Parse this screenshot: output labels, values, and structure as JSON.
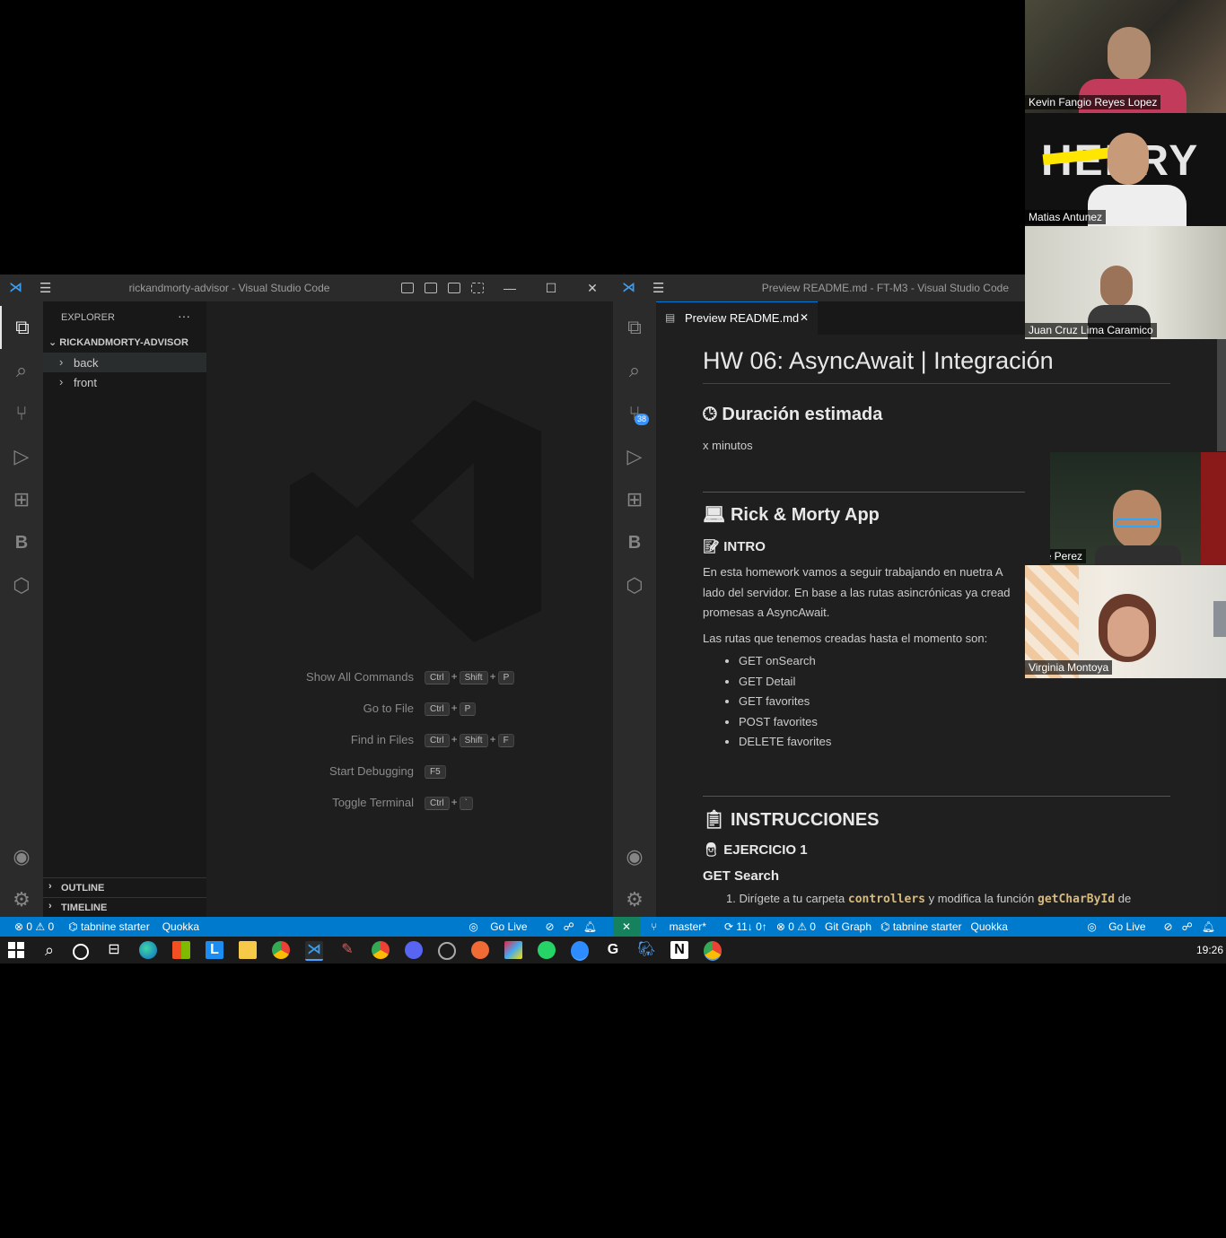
{
  "left_window": {
    "title": "rickandmorty-advisor - Visual Studio Code",
    "explorer_label": "EXPLORER",
    "explorer_more": "···",
    "root_folder": "RICKANDMORTY-ADVISOR",
    "folders": [
      "back",
      "front"
    ],
    "outline_label": "OUTLINE",
    "timeline_label": "TIMELINE",
    "shortcuts": [
      {
        "label": "Show All Commands",
        "keys": [
          "Ctrl",
          "+",
          "Shift",
          "+",
          "P"
        ]
      },
      {
        "label": "Go to File",
        "keys": [
          "Ctrl",
          "+",
          "P"
        ]
      },
      {
        "label": "Find in Files",
        "keys": [
          "Ctrl",
          "+",
          "Shift",
          "+",
          "F"
        ]
      },
      {
        "label": "Start Debugging",
        "keys": [
          "F5"
        ]
      },
      {
        "label": "Toggle Terminal",
        "keys": [
          "Ctrl",
          "+",
          "`"
        ]
      }
    ],
    "status": {
      "errors": "⊗ 0 ⚠ 0",
      "tabnine": "⌬ tabnine starter",
      "quokka": "Quokka",
      "golive": "Go Live"
    }
  },
  "right_window": {
    "title": "Preview README.md - FT-M3 - Visual Studio Code",
    "tab_label": "Preview README.md",
    "tab_close": "✕",
    "scm_badge": "38",
    "status": {
      "remote": "✕",
      "branch": "master*",
      "sync": "⟳ 11↓ 0↑",
      "errors": "⊗ 0 ⚠ 0",
      "gitgraph": "Git Graph",
      "tabnine": "⌬ tabnine starter",
      "quokka": "Quokka",
      "golive": "Go Live"
    }
  },
  "readme": {
    "h1": "HW 06: AsyncAwait | Integración",
    "duration_heading": "Duración estimada",
    "duration_text": "x minutos",
    "app_heading": "Rick & Morty App",
    "intro_heading": "INTRO",
    "intro_p1_line1": "En esta homework vamos a seguir trabajando en nuetra A",
    "intro_p1_line2": "lado del servidor. En base a las rutas asincrónicas ya cread",
    "intro_p1_line3": "promesas a AsyncAwait.",
    "routes_intro": "Las rutas que tenemos creadas hasta el momento son:",
    "routes": [
      "GET onSearch",
      "GET Detail",
      "GET favorites",
      "POST favorites",
      "DELETE favorites"
    ],
    "instructions_heading": "INSTRUCCIONES",
    "exercise_heading": "EJERCICIO 1",
    "get_search_heading": "GET Search",
    "step1_prefix": "1. Dirígete a tu carpeta",
    "step1_code1": "controllers",
    "step1_mid": "y modifica la función",
    "step1_code2": "getCharById",
    "step1_suffix": "de"
  },
  "participants": [
    "Kevin Fangio Reyes Lopez",
    "Matias Antunez",
    "Juan Cruz Lima Caramico",
    "Jose Perez",
    "Virginia Montoya"
  ],
  "henry_logo_text": "HENRY",
  "taskbar": {
    "time": "19:26"
  }
}
